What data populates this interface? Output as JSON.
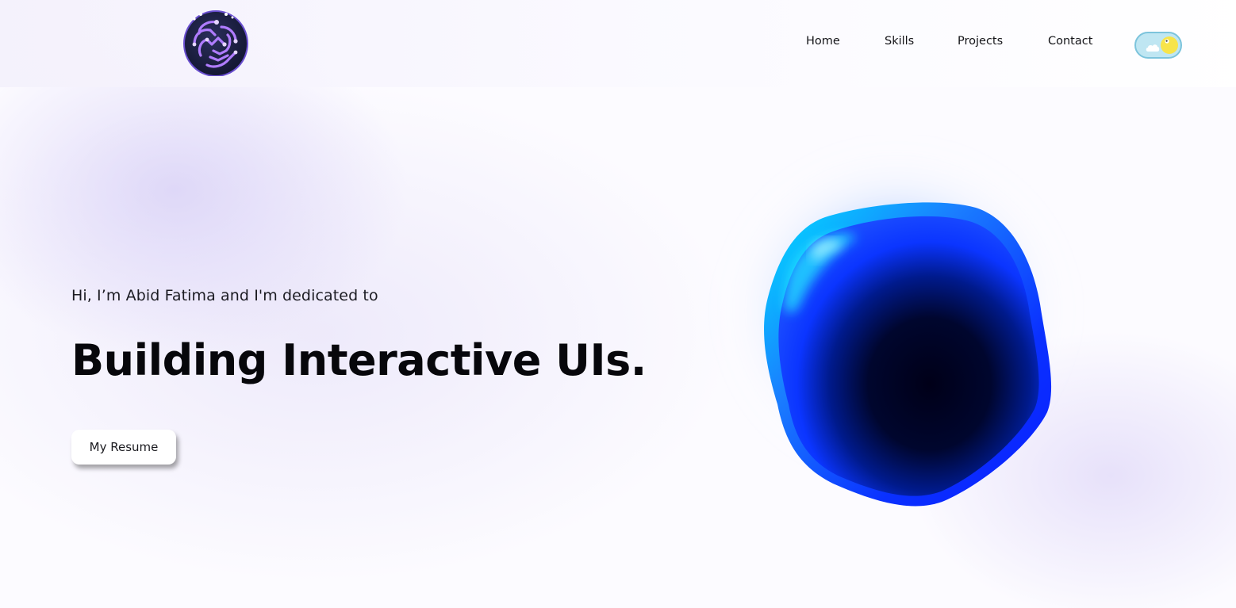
{
  "header": {
    "logo_icon": "circuit-brain-logo-icon",
    "nav": [
      {
        "label": "Home"
      },
      {
        "label": "Skills"
      },
      {
        "label": "Projects"
      },
      {
        "label": "Contact"
      }
    ],
    "theme_toggle": {
      "state": "light",
      "icons": [
        "cloud-icon",
        "moon-icon"
      ],
      "colors": {
        "track": "#bfe6f2",
        "knob": "#f7e44a"
      }
    }
  },
  "hero": {
    "intro": "Hi, I’m Abid Fatima and I'm dedicated to",
    "headline": "Building Interactive UIs.",
    "resume_button": "My Resume"
  },
  "visual": {
    "blob_icon": "3d-blob-icon",
    "colors": {
      "edge": "#0a2bff",
      "highlight": "#00d2ff",
      "core": "#000024"
    }
  }
}
